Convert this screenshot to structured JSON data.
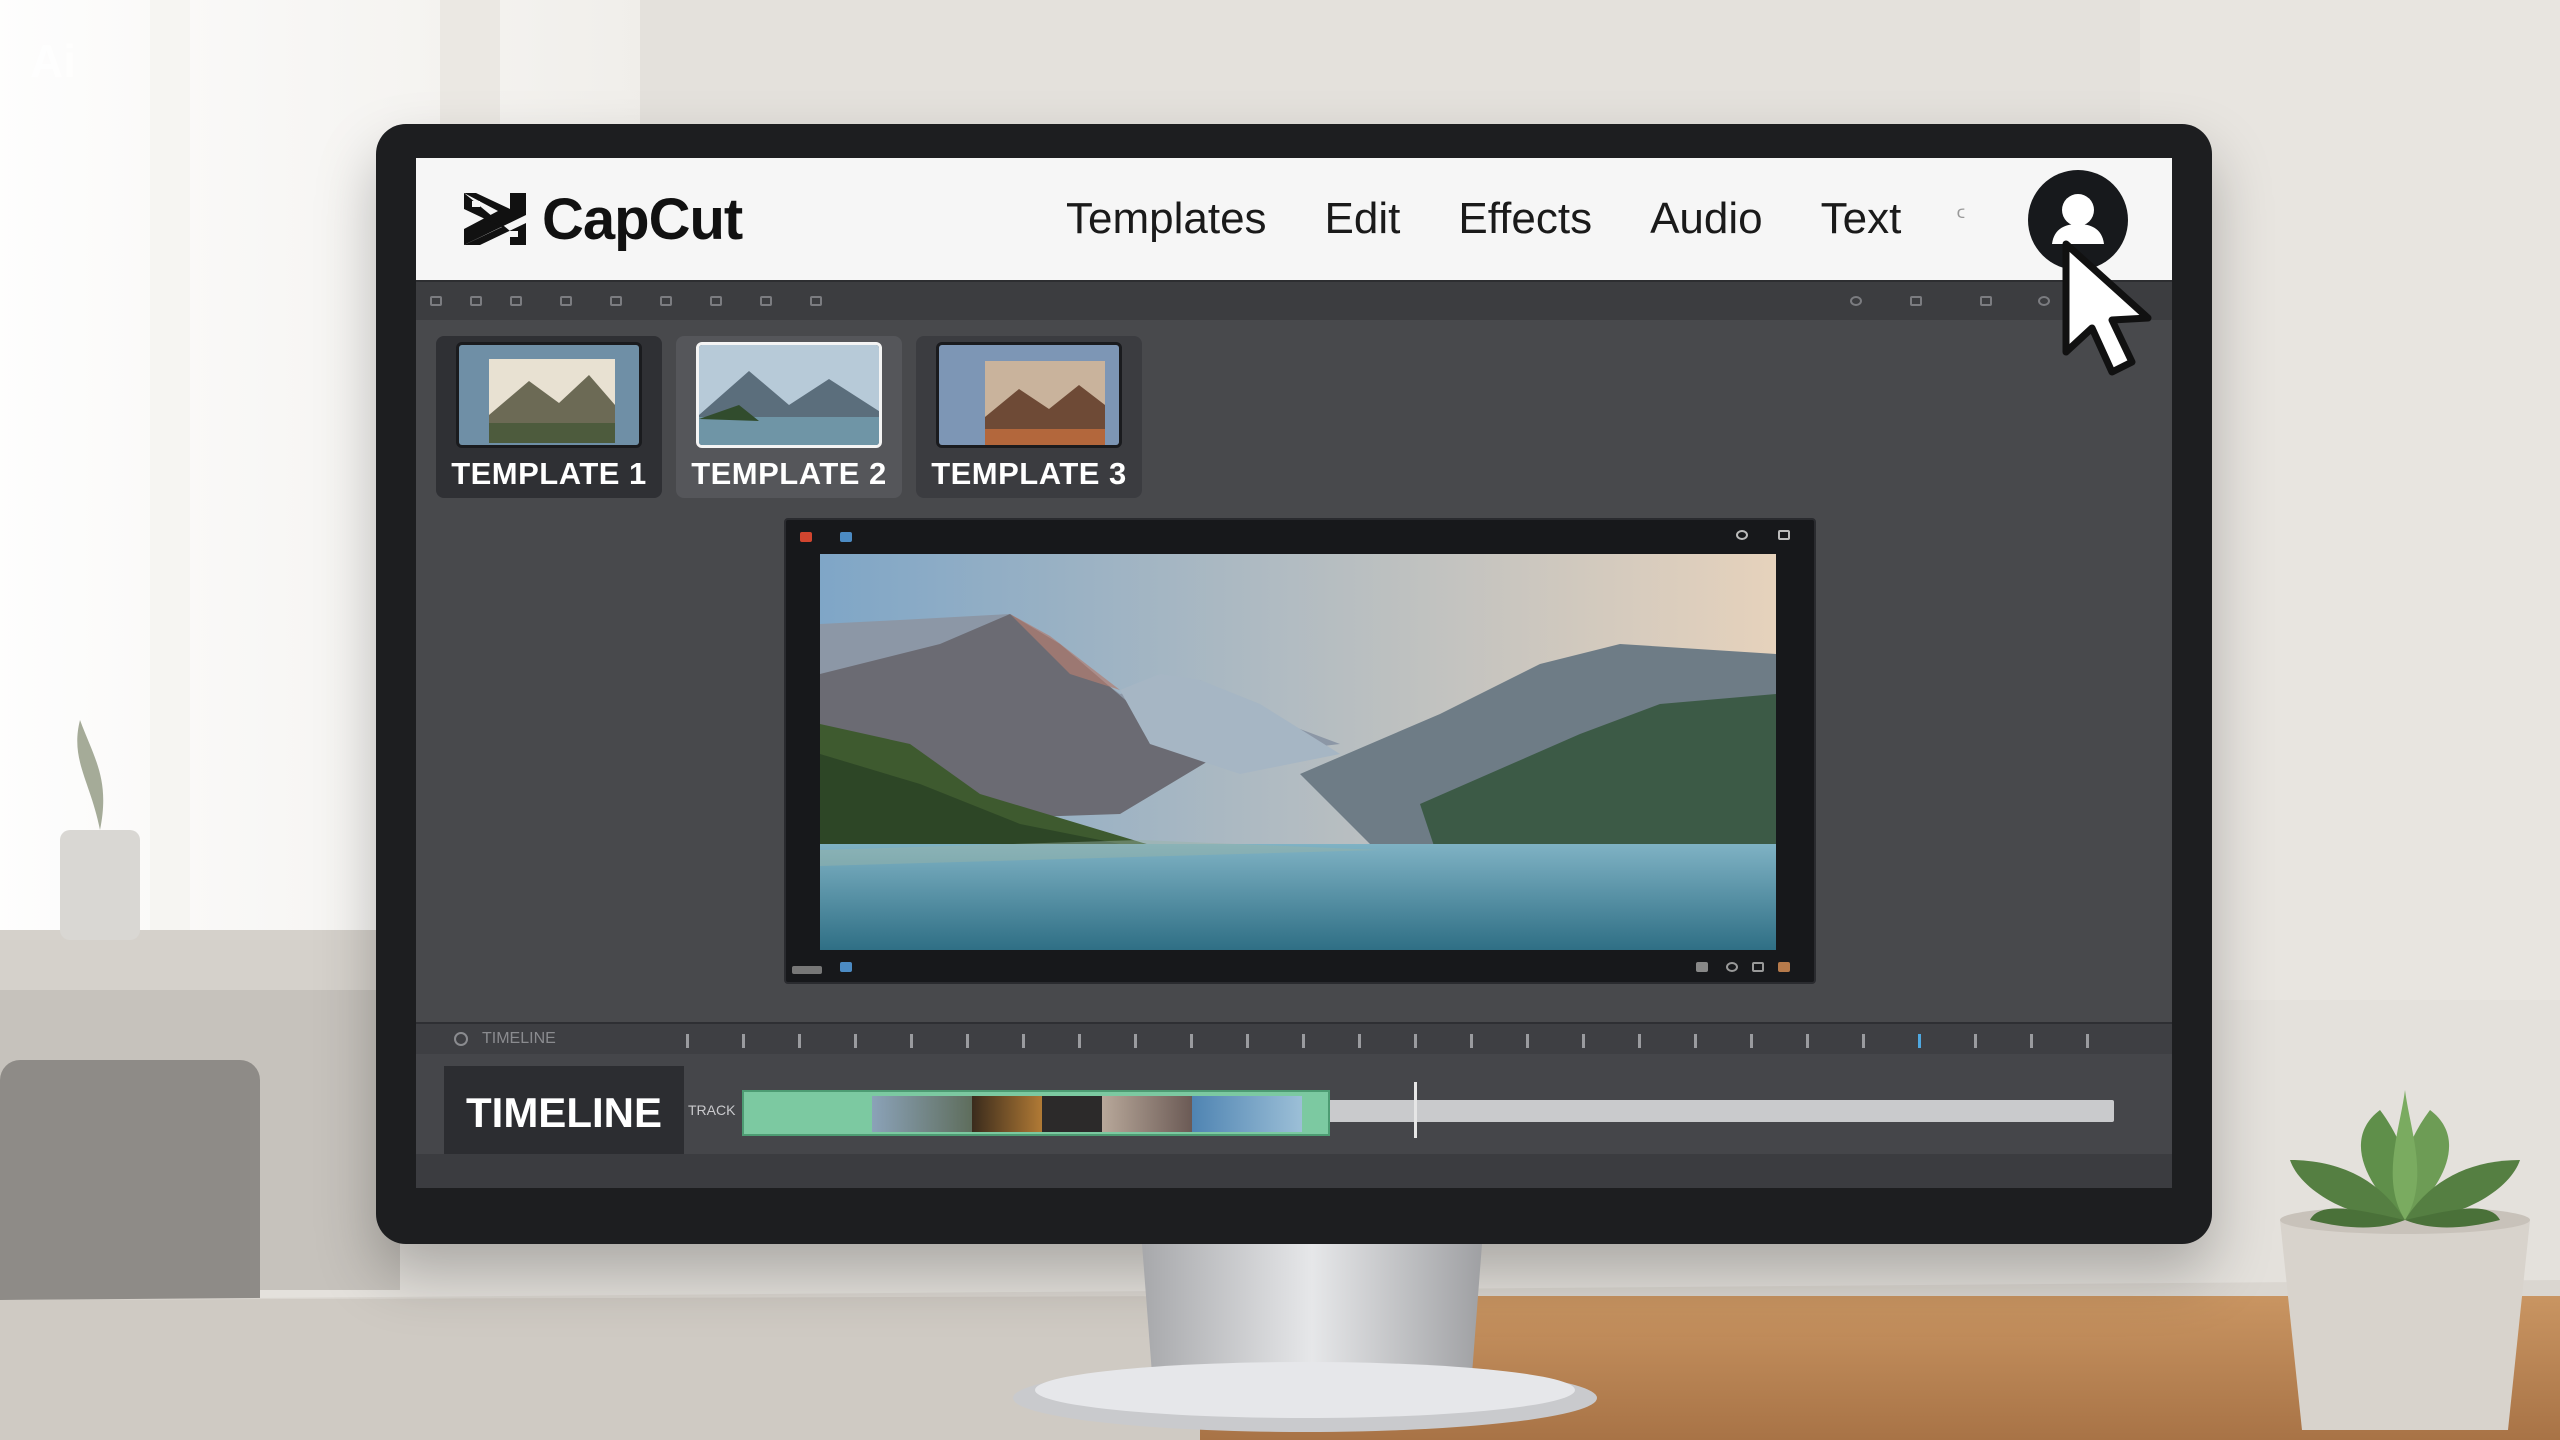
{
  "watermark": "Ai",
  "app": {
    "brand_name": "CapCut",
    "nav": [
      "Templates",
      "Edit",
      "Effects",
      "Audio",
      "Text"
    ],
    "nav_extra": "ᑦ"
  },
  "templates": [
    {
      "label": "TEMPLATE 1"
    },
    {
      "label": "TEMPLATE 2"
    },
    {
      "label": "TEMPLATE 3"
    }
  ],
  "timeline": {
    "title": "TIMELINE",
    "ruler_label": "TIMELINE",
    "track_label": "TRACK"
  },
  "colors": {
    "header_bg": "#f6f6f6",
    "editor_bg": "#48494c",
    "clip_green": "#7cc9a1",
    "avatar_bg": "#17191c"
  },
  "icons": [
    "capcut-logo-icon",
    "user-avatar-icon",
    "mouse-pointer-icon"
  ]
}
